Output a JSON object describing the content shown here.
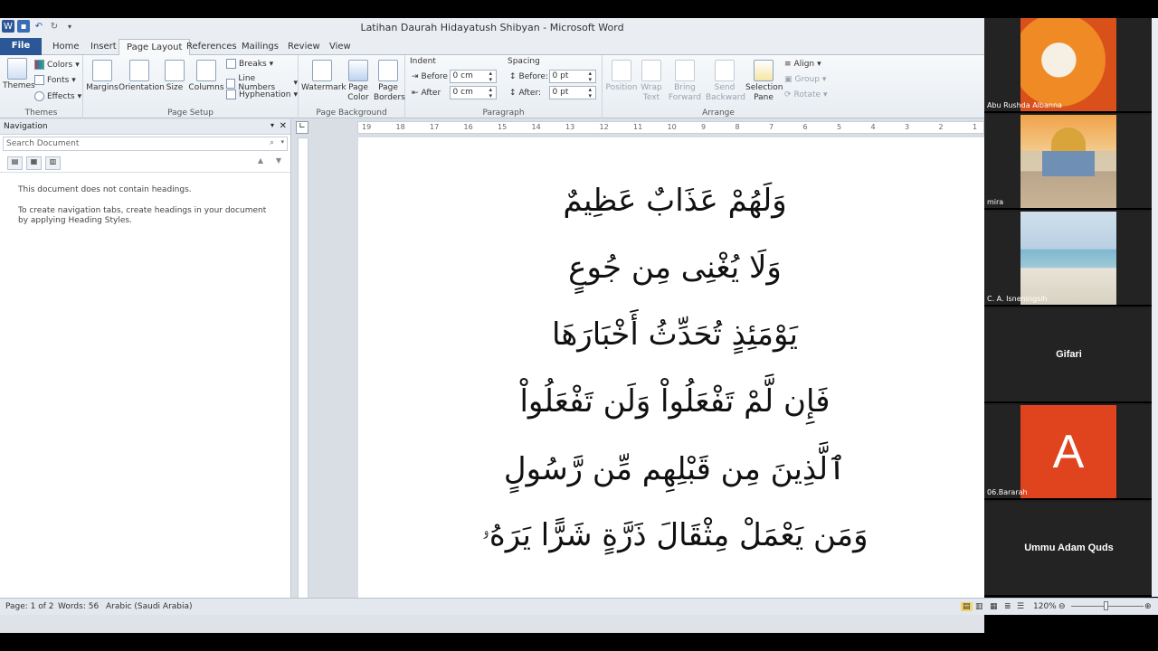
{
  "window": {
    "title": "Latihan Daurah Hidayatush Shibyan  -  Microsoft Word"
  },
  "tabs": [
    {
      "label": "File"
    },
    {
      "label": "Home"
    },
    {
      "label": "Insert"
    },
    {
      "label": "Page Layout"
    },
    {
      "label": "References"
    },
    {
      "label": "Mailings"
    },
    {
      "label": "Review"
    },
    {
      "label": "View"
    }
  ],
  "ribbon": {
    "themes": {
      "themes_label": "Themes",
      "colors": "Colors",
      "fonts": "Fonts",
      "effects": "Effects",
      "group": "Themes"
    },
    "page_setup": {
      "margins": "Margins",
      "orientation": "Orientation",
      "size": "Size",
      "columns": "Columns",
      "breaks": "Breaks",
      "line_numbers": "Line Numbers",
      "hyphenation": "Hyphenation",
      "group": "Page Setup"
    },
    "page_background": {
      "watermark": "Watermark",
      "page_color": "Page Color",
      "page_borders": "Page Borders",
      "group": "Page Background"
    },
    "paragraph": {
      "indent": "Indent",
      "before_label": "Before",
      "before_value": "0 cm",
      "after_label": "After",
      "after_value": "0 cm",
      "spacing": "Spacing",
      "sp_before_label": "Before:",
      "sp_before_value": "0 pt",
      "sp_after_label": "After:",
      "sp_after_value": "0 pt",
      "group": "Paragraph"
    },
    "arrange": {
      "position": "Position",
      "wrap_text": "Wrap Text",
      "bring_forward": "Bring Forward",
      "send_backward": "Send Backward",
      "selection_pane": "Selection Pane",
      "align": "Align",
      "group_btn": "Group",
      "rotate": "Rotate",
      "group": "Arrange"
    }
  },
  "navigation": {
    "title": "Navigation",
    "search_placeholder": "Search Document",
    "msg1": "This document does not contain headings.",
    "msg2": "To create navigation tabs, create headings in your document by applying Heading Styles."
  },
  "ruler": {
    "ticks": [
      "19",
      "18",
      "17",
      "16",
      "15",
      "14",
      "13",
      "12",
      "11",
      "10",
      "9",
      "8",
      "7",
      "6",
      "5",
      "4",
      "3",
      "2",
      "1"
    ]
  },
  "document": {
    "lines": [
      "وَلَهُمْ عَذَابٌ عَظِيمٌ",
      "وَلَا يُغْنِى مِن جُوعٍ",
      "يَوْمَئِذٍ تُحَدِّثُ أَخْبَارَهَا",
      "فَإِن لَّمْ تَفْعَلُواْ وَلَن تَفْعَلُواْ",
      "ٱلَّذِينَ مِن قَبْلِهِم مِّن رَّسُولٍ",
      "وَمَن يَعْمَلْ مِثْقَالَ ذَرَّةٍ شَرًّا يَرَهُۥ"
    ]
  },
  "status": {
    "page": "Page: 1 of 2",
    "words": "Words: 56",
    "language": "Arabic (Saudi Arabia)",
    "zoom": "120%"
  },
  "participants": [
    {
      "name": "Abu Rushda Albanna",
      "type": "poster"
    },
    {
      "name": "mira",
      "type": "mosque"
    },
    {
      "name": "C. A. Isneningsih",
      "type": "beach"
    },
    {
      "name": "Gifari",
      "type": "text"
    },
    {
      "name": "06.Bararah",
      "type": "avatar",
      "initial": "A"
    },
    {
      "name": "Ummu Adam Quds",
      "type": "text"
    }
  ],
  "colors": {
    "file_tab": "#2b5797",
    "avatar_bg": "#e0441f"
  }
}
